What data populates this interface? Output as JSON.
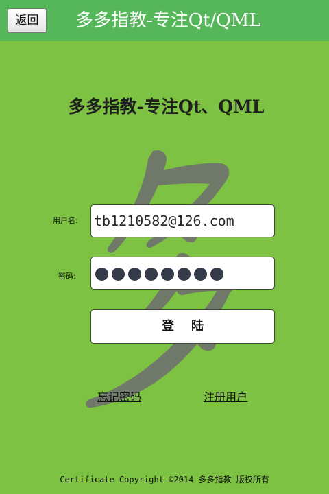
{
  "header": {
    "back_label": "返回",
    "title": "多多指教-专注Qt/QML"
  },
  "main": {
    "heading": "多多指教-专注Qt、QML",
    "username_label": "用户名:",
    "username_value": "tb1210582@126.com",
    "password_label": "密码:",
    "password_masked_length": 8,
    "login_label": "登    陆",
    "forgot_link": "忘记密码",
    "register_link": "注册用户"
  },
  "footer": {
    "copyright": "Certificate Copyright ©2014 多多指教 版权所有"
  },
  "colors": {
    "background": "#7dc242",
    "header_bar": "#56b65a",
    "watermark": "#6f6f6f"
  },
  "icons": {
    "watermark": "duo-character-watermark"
  }
}
